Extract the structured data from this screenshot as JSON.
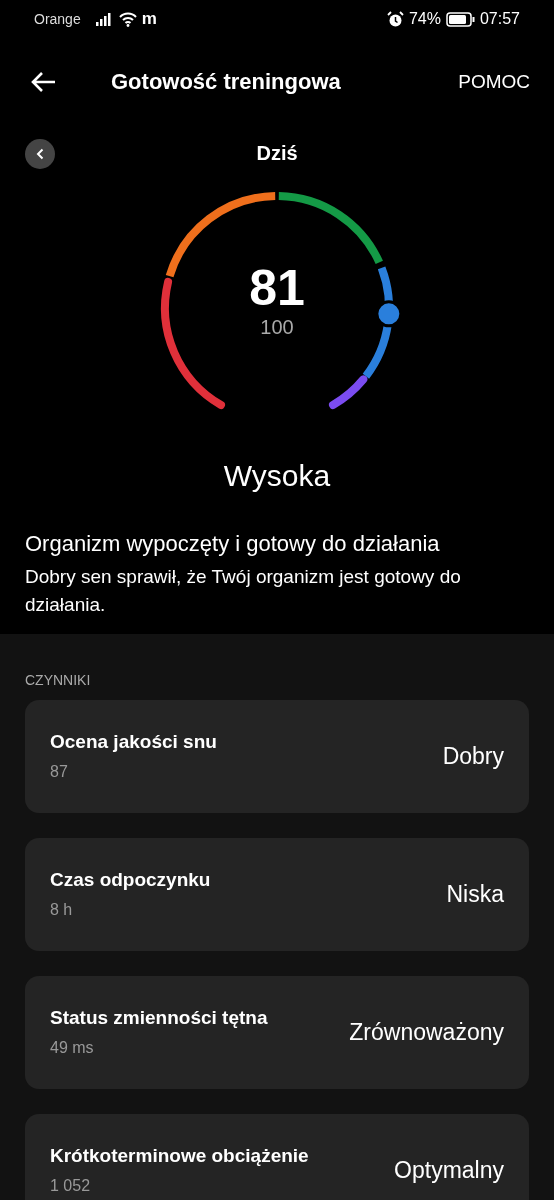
{
  "status_bar": {
    "carrier": "Orange",
    "network_badge": "m",
    "battery": "74%",
    "time": "07:57"
  },
  "header": {
    "title": "Gotowość treningowa",
    "help": "POMOC"
  },
  "date": {
    "label": "Dziś"
  },
  "gauge": {
    "score": "81",
    "max": "100"
  },
  "rating": "Wysoka",
  "summary": {
    "heading": "Organizm wypoczęty i gotowy do działania",
    "text": "Dobry sen sprawił, że Twój organizm jest gotowy do działania."
  },
  "factors": {
    "title": "CZYNNIKI",
    "items": [
      {
        "name": "Ocena jakości snu",
        "value": "87",
        "status": "Dobry"
      },
      {
        "name": "Czas odpoczynku",
        "value": "8 h",
        "status": "Niska"
      },
      {
        "name": "Status zmienności tętna",
        "value": "49 ms",
        "status": "Zrównoważony"
      },
      {
        "name": "Krótkoterminowe obciążenie",
        "value": "1 052",
        "status": "Optymalny"
      }
    ]
  }
}
